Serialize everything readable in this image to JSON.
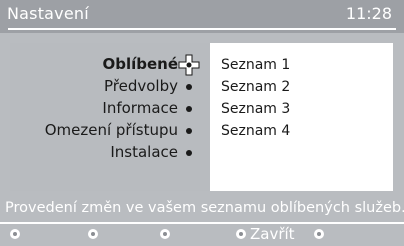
{
  "header": {
    "title": "Nastavení",
    "clock": "11:28"
  },
  "menu": {
    "selected_index": 0,
    "items": [
      {
        "label": "Oblíbené"
      },
      {
        "label": "Předvolby"
      },
      {
        "label": "Informace"
      },
      {
        "label": "Omezení přístupu"
      },
      {
        "label": "Instalace"
      }
    ]
  },
  "lists": [
    {
      "label": "Seznam 1"
    },
    {
      "label": "Seznam 2"
    },
    {
      "label": "Seznam 3"
    },
    {
      "label": "Seznam 4"
    }
  ],
  "info": {
    "text": "Provedení změn ve vašem seznamu oblíbených služeb."
  },
  "buttons": {
    "close_label": "Zavřít"
  },
  "colors": {
    "background": "#b9bcc0",
    "title_bar": "#9da0a5",
    "panel": "#ffffff",
    "text": "#1a1a1a"
  },
  "icons": {
    "navigation": "navigation-cross-icon"
  }
}
